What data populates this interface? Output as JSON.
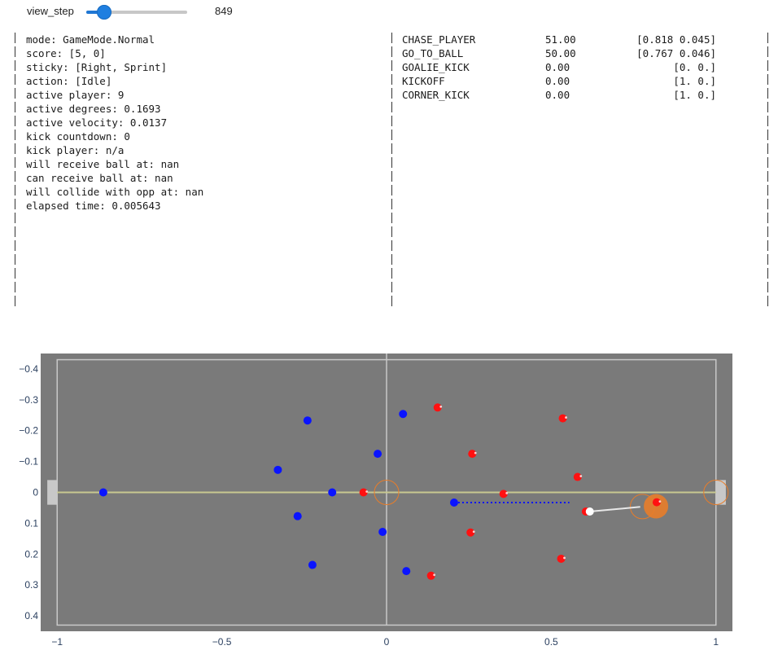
{
  "slider": {
    "label": "view_step",
    "value": "849",
    "fraction": 0.178
  },
  "state": {
    "lines": [
      "mode: GameMode.Normal",
      "score: [5, 0]",
      "sticky: [Right, Sprint]",
      "action: [Idle]",
      "active player: 9",
      "active degrees: 0.1693",
      "active velocity: 0.0137",
      "kick countdown: 0",
      "kick player: n/a",
      "will receive ball at: nan",
      "can receive ball at: nan",
      "will collide with opp at: nan",
      "elapsed time: 0.005643"
    ]
  },
  "actions_table": {
    "rows": [
      {
        "name": "CHASE_PLAYER",
        "score": "51.00",
        "vec": "[0.818 0.045]"
      },
      {
        "name": "GO_TO_BALL",
        "score": "50.00",
        "vec": "[0.767 0.046]"
      },
      {
        "name": "GOALIE_KICK",
        "score": "0.00",
        "vec": "[0. 0.]"
      },
      {
        "name": "KICKOFF",
        "score": "0.00",
        "vec": "[1. 0.]"
      },
      {
        "name": "CORNER_KICK",
        "score": "0.00",
        "vec": "[1. 0.]"
      }
    ]
  },
  "chart_data": {
    "type": "scatter",
    "xlim": [
      -1.05,
      1.05
    ],
    "ylim": [
      0.45,
      -0.45
    ],
    "y_reversed": true,
    "xticks": [
      "−1",
      "−0.5",
      "0",
      "0.5",
      "1"
    ],
    "xtick_values": [
      -1,
      -0.5,
      0,
      0.5,
      1
    ],
    "yticks": [
      "−0.4",
      "−0.3",
      "−0.2",
      "−0.1",
      "0",
      "0.1",
      "0.2",
      "0.3",
      "0.4"
    ],
    "ytick_values": [
      -0.4,
      -0.3,
      -0.2,
      -0.1,
      0,
      0.1,
      0.2,
      0.3,
      0.4
    ],
    "grid": false,
    "colors": {
      "field": "#7a7a7a",
      "lines": "#c8c8c8",
      "center_line": "#c8c890",
      "team_blue": "#0a14ff",
      "team_red": "#ff1111",
      "ball": "#ffffff",
      "highlight": "#e87d2a"
    },
    "blue_team": [
      {
        "x": -0.86,
        "y": 0.0
      },
      {
        "x": -0.24,
        "y": -0.233
      },
      {
        "x": -0.33,
        "y": -0.073
      },
      {
        "x": -0.165,
        "y": 0.0
      },
      {
        "x": -0.27,
        "y": 0.077
      },
      {
        "x": -0.225,
        "y": 0.235
      },
      {
        "x": -0.027,
        "y": -0.125
      },
      {
        "x": -0.012,
        "y": 0.128
      },
      {
        "x": 0.05,
        "y": -0.254
      },
      {
        "x": 0.06,
        "y": 0.255
      },
      {
        "x": 0.205,
        "y": 0.033
      }
    ],
    "red_team": [
      {
        "x": -0.07,
        "y": 0.0
      },
      {
        "x": 0.155,
        "y": -0.275
      },
      {
        "x": 0.26,
        "y": -0.125
      },
      {
        "x": 0.355,
        "y": 0.005
      },
      {
        "x": 0.255,
        "y": 0.13
      },
      {
        "x": 0.135,
        "y": 0.27
      },
      {
        "x": 0.535,
        "y": -0.24
      },
      {
        "x": 0.58,
        "y": -0.05
      },
      {
        "x": 0.605,
        "y": 0.062
      },
      {
        "x": 0.53,
        "y": 0.215
      },
      {
        "x": 0.82,
        "y": 0.032
      }
    ],
    "ball": {
      "x": 0.617,
      "y": 0.062
    },
    "ball_velocity_to": {
      "x": 0.77,
      "y": 0.047
    },
    "pass_line": {
      "x0": 0.205,
      "y0": 0.033,
      "x1": 0.555,
      "y1": 0.033
    },
    "targets": [
      {
        "x": 0.0,
        "y": 0.0
      },
      {
        "x": 0.777,
        "y": 0.046
      },
      {
        "x": 1.0,
        "y": 0.0
      }
    ],
    "highlight_player": {
      "x": 0.818,
      "y": 0.045
    }
  }
}
